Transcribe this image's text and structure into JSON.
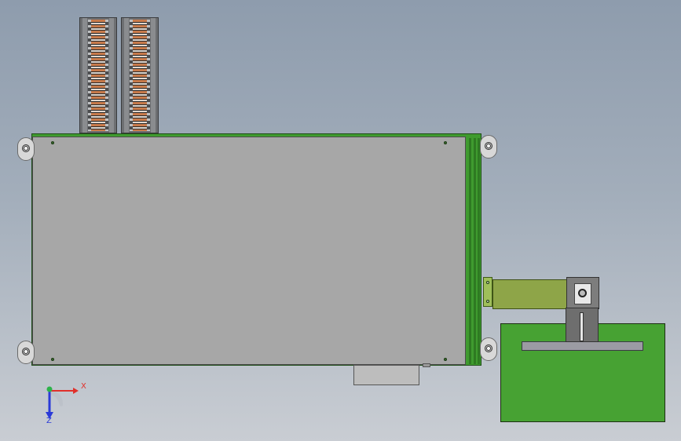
{
  "triad": {
    "x_label": "X",
    "z_label": "Z",
    "colors": {
      "x_axis": "#e0302a",
      "y_axis": "#2db34a",
      "z_axis": "#2a3ad8"
    }
  },
  "colors": {
    "frame_green": "#3f9b2f",
    "plate_gray": "#a7a7a7",
    "table_green": "#47a233",
    "arm_olive": "#8ea548",
    "background_top": "#8e9cad"
  },
  "icons": [
    "feeder-magazine",
    "mounting-foot",
    "orientation-triad"
  ]
}
